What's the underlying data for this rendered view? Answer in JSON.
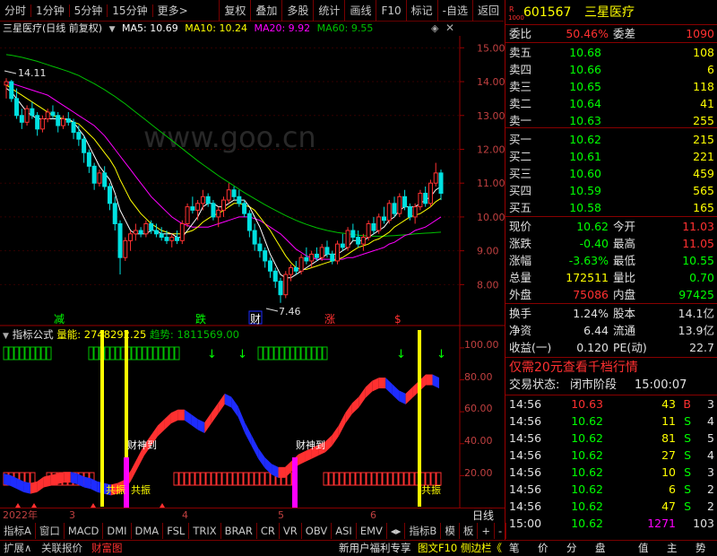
{
  "toolbar": {
    "left": [
      "分时",
      "1分钟",
      "5分钟",
      "15分钟",
      "更多>"
    ],
    "right": [
      "复权",
      "叠加",
      "多股",
      "统计",
      "画线",
      "F10",
      "标记",
      "-自选",
      "返回"
    ]
  },
  "info": {
    "stock": "三星医疗",
    "mode": "(日线 前复权)",
    "ma5": "MA5: 10.69",
    "ma10": "MA10: 10.24",
    "ma20": "MA20: 9.92",
    "ma60": "MA60: 9.55"
  },
  "watermark": "www.goo.cn",
  "colors": {
    "up": "#ff3232",
    "down": "#00e0e0",
    "ma5": "#ffffff",
    "ma10": "#ffff00",
    "ma20": "#ff00ff",
    "ma60": "#00c000",
    "green": "#00ff00",
    "red": "#ff3030",
    "yellow": "#ffff00",
    "cyan": "#00ffff",
    "blue": "#1e2cff",
    "magenta": "#ff00ff"
  },
  "price_axis": [
    "15.00",
    "14.00",
    "13.00",
    "12.00",
    "11.00",
    "10.00",
    "9.00",
    "8.00"
  ],
  "high_label": "14.11",
  "low_label": "7.46",
  "markers": {
    "jian": "减",
    "die": "跌",
    "cai": "财",
    "zhang": "涨",
    "dollar": "$"
  },
  "indicator": {
    "name": "指标公式",
    "liangneng": "量能: 2748292.25",
    "qushi": "趋势: 1811569.00",
    "axis": [
      "100.00",
      "80.00",
      "60.00",
      "40.00",
      "20.00"
    ],
    "caishen": "财神到",
    "gongzhen": "共振"
  },
  "chart_data": {
    "type": "candlestick",
    "ylim": [
      7.4,
      15.3
    ],
    "candles": [
      [
        13.9,
        14.1,
        13.5,
        14.0
      ],
      [
        14.0,
        14.05,
        13.4,
        13.5
      ],
      [
        13.5,
        13.8,
        12.9,
        13.0
      ],
      [
        13.0,
        13.2,
        12.6,
        12.8
      ],
      [
        12.8,
        13.3,
        12.7,
        13.2
      ],
      [
        13.2,
        13.4,
        12.9,
        13.0
      ],
      [
        13.0,
        13.1,
        12.4,
        12.6
      ],
      [
        12.6,
        13.0,
        12.5,
        12.9
      ],
      [
        12.9,
        13.2,
        12.8,
        13.1
      ],
      [
        13.1,
        13.3,
        12.9,
        13.0
      ],
      [
        13.0,
        13.1,
        12.5,
        12.7
      ],
      [
        12.7,
        13.0,
        12.6,
        12.9
      ],
      [
        12.9,
        13.1,
        12.7,
        12.8
      ],
      [
        12.8,
        12.9,
        12.3,
        12.5
      ],
      [
        12.5,
        12.7,
        12.1,
        12.3
      ],
      [
        12.3,
        12.4,
        11.6,
        11.9
      ],
      [
        11.9,
        12.0,
        11.3,
        11.5
      ],
      [
        11.5,
        11.6,
        10.8,
        11.0
      ],
      [
        11.0,
        11.4,
        10.9,
        11.3
      ],
      [
        11.3,
        11.5,
        10.8,
        10.9
      ],
      [
        10.9,
        11.0,
        10.2,
        10.4
      ],
      [
        10.4,
        10.6,
        9.6,
        9.8
      ],
      [
        9.8,
        9.9,
        8.3,
        8.8
      ],
      [
        8.8,
        9.4,
        8.7,
        9.3
      ],
      [
        9.3,
        9.6,
        9.0,
        9.5
      ],
      [
        9.5,
        9.8,
        9.3,
        9.6
      ],
      [
        9.6,
        9.7,
        9.4,
        9.5
      ],
      [
        9.5,
        9.9,
        9.4,
        9.8
      ],
      [
        9.8,
        9.9,
        9.5,
        9.6
      ],
      [
        9.6,
        9.8,
        9.4,
        9.5
      ],
      [
        9.5,
        9.7,
        9.3,
        9.4
      ],
      [
        9.4,
        9.6,
        9.2,
        9.3
      ],
      [
        9.3,
        9.5,
        9.1,
        9.4
      ],
      [
        9.4,
        9.6,
        9.2,
        9.3
      ],
      [
        9.3,
        9.9,
        9.2,
        9.8
      ],
      [
        9.8,
        10.4,
        9.7,
        10.3
      ],
      [
        10.3,
        10.6,
        10.1,
        10.2
      ],
      [
        10.2,
        10.5,
        9.9,
        10.4
      ],
      [
        10.4,
        10.8,
        10.2,
        10.6
      ],
      [
        10.6,
        10.7,
        10.3,
        10.4
      ],
      [
        10.4,
        10.5,
        9.9,
        10.0
      ],
      [
        10.0,
        10.3,
        9.7,
        10.2
      ],
      [
        10.2,
        10.6,
        10.0,
        10.5
      ],
      [
        10.5,
        11.0,
        10.4,
        10.8
      ],
      [
        10.8,
        10.9,
        10.5,
        10.6
      ],
      [
        10.6,
        10.8,
        10.3,
        10.4
      ],
      [
        10.4,
        10.5,
        10.0,
        10.1
      ],
      [
        10.1,
        10.2,
        9.4,
        9.6
      ],
      [
        9.6,
        9.8,
        9.0,
        9.2
      ],
      [
        9.2,
        9.4,
        8.8,
        9.0
      ],
      [
        9.0,
        9.1,
        8.5,
        8.7
      ],
      [
        8.7,
        8.8,
        8.2,
        8.4
      ],
      [
        8.4,
        8.5,
        7.9,
        8.1
      ],
      [
        8.1,
        8.2,
        7.46,
        7.7
      ],
      [
        7.7,
        8.4,
        7.6,
        8.3
      ],
      [
        8.3,
        8.6,
        8.1,
        8.5
      ],
      [
        8.5,
        8.7,
        8.3,
        8.4
      ],
      [
        8.4,
        8.9,
        8.3,
        8.8
      ],
      [
        8.8,
        9.1,
        8.6,
        8.7
      ],
      [
        8.7,
        9.0,
        8.5,
        8.9
      ],
      [
        8.9,
        9.1,
        8.7,
        8.8
      ],
      [
        8.8,
        9.2,
        8.7,
        9.1
      ],
      [
        9.1,
        9.3,
        8.8,
        8.9
      ],
      [
        8.9,
        9.0,
        8.6,
        8.7
      ],
      [
        8.7,
        9.3,
        8.6,
        9.2
      ],
      [
        9.2,
        9.5,
        9.0,
        9.1
      ],
      [
        9.1,
        9.7,
        9.0,
        9.6
      ],
      [
        9.6,
        9.8,
        9.3,
        9.4
      ],
      [
        9.4,
        9.6,
        9.1,
        9.2
      ],
      [
        9.2,
        9.5,
        9.0,
        9.4
      ],
      [
        9.4,
        9.9,
        9.3,
        9.8
      ],
      [
        9.8,
        10.0,
        9.5,
        9.6
      ],
      [
        9.6,
        10.1,
        9.5,
        10.0
      ],
      [
        10.0,
        10.3,
        9.8,
        9.9
      ],
      [
        9.9,
        10.5,
        9.8,
        10.4
      ],
      [
        10.4,
        10.6,
        10.0,
        10.1
      ],
      [
        10.1,
        10.7,
        10.0,
        10.6
      ],
      [
        10.6,
        10.8,
        10.2,
        10.3
      ],
      [
        10.3,
        10.4,
        9.9,
        10.0
      ],
      [
        10.0,
        10.4,
        9.8,
        10.3
      ],
      [
        10.3,
        10.8,
        10.2,
        10.7
      ],
      [
        10.7,
        10.9,
        10.3,
        10.4
      ],
      [
        10.4,
        11.1,
        10.3,
        11.0
      ],
      [
        11.0,
        11.6,
        10.9,
        11.3
      ],
      [
        11.3,
        11.4,
        10.5,
        10.7
      ]
    ],
    "ma5": [
      13.8,
      13.7,
      13.5,
      13.3,
      13.1,
      13.0,
      12.9,
      12.9,
      12.9,
      12.9,
      12.9,
      12.9,
      12.9,
      12.8,
      12.6,
      12.4,
      12.1,
      11.8,
      11.5,
      11.3,
      11.1,
      10.7,
      10.2,
      9.9,
      9.6,
      9.5,
      9.5,
      9.5,
      9.6,
      9.6,
      9.5,
      9.5,
      9.5,
      9.4,
      9.4,
      9.6,
      9.8,
      10.0,
      10.3,
      10.4,
      10.4,
      10.3,
      10.3,
      10.4,
      10.5,
      10.5,
      10.5,
      10.3,
      10.0,
      9.7,
      9.3,
      8.9,
      8.6,
      8.3,
      8.2,
      8.2,
      8.3,
      8.4,
      8.5,
      8.6,
      8.7,
      8.8,
      8.9,
      8.9,
      8.9,
      9.0,
      9.1,
      9.3,
      9.3,
      9.3,
      9.4,
      9.5,
      9.6,
      9.7,
      9.9,
      10.0,
      10.2,
      10.3,
      10.3,
      10.3,
      10.4,
      10.5,
      10.6,
      10.8,
      10.9
    ],
    "ma10": [
      13.9,
      13.8,
      13.7,
      13.6,
      13.5,
      13.4,
      13.3,
      13.2,
      13.1,
      13.0,
      12.95,
      12.9,
      12.85,
      12.8,
      12.75,
      12.6,
      12.45,
      12.3,
      12.1,
      11.9,
      11.7,
      11.45,
      11.1,
      10.8,
      10.5,
      10.3,
      10.1,
      9.95,
      9.8,
      9.7,
      9.6,
      9.55,
      9.5,
      9.5,
      9.5,
      9.55,
      9.6,
      9.7,
      9.85,
      9.95,
      10.05,
      10.1,
      10.2,
      10.3,
      10.4,
      10.4,
      10.35,
      10.3,
      10.2,
      10.0,
      9.8,
      9.6,
      9.35,
      9.1,
      8.85,
      8.65,
      8.5,
      8.45,
      8.45,
      8.5,
      8.55,
      8.6,
      8.65,
      8.7,
      8.75,
      8.8,
      8.9,
      9.0,
      9.1,
      9.15,
      9.2,
      9.3,
      9.35,
      9.45,
      9.55,
      9.7,
      9.8,
      9.9,
      10.0,
      10.05,
      10.1,
      10.2,
      10.3,
      10.45,
      10.55
    ],
    "ma20": [
      14.0,
      13.95,
      13.9,
      13.85,
      13.8,
      13.75,
      13.7,
      13.65,
      13.6,
      13.5,
      13.4,
      13.3,
      13.2,
      13.1,
      13.0,
      12.9,
      12.8,
      12.7,
      12.55,
      12.4,
      12.2,
      12.0,
      11.8,
      11.6,
      11.4,
      11.2,
      11.0,
      10.8,
      10.6,
      10.45,
      10.3,
      10.15,
      10.0,
      9.9,
      9.8,
      9.75,
      9.7,
      9.7,
      9.7,
      9.7,
      9.75,
      9.8,
      9.85,
      9.9,
      9.95,
      10.0,
      10.0,
      10.0,
      9.95,
      9.9,
      9.8,
      9.7,
      9.6,
      9.5,
      9.35,
      9.2,
      9.05,
      8.95,
      8.85,
      8.8,
      8.75,
      8.75,
      8.75,
      8.75,
      8.75,
      8.75,
      8.8,
      8.8,
      8.85,
      8.9,
      8.95,
      9.0,
      9.05,
      9.1,
      9.2,
      9.25,
      9.35,
      9.45,
      9.5,
      9.6,
      9.65,
      9.7,
      9.8,
      9.9,
      10.0
    ],
    "ma60": [
      14.8,
      14.78,
      14.75,
      14.72,
      14.68,
      14.64,
      14.6,
      14.55,
      14.5,
      14.45,
      14.4,
      14.35,
      14.3,
      14.24,
      14.18,
      14.1,
      14.02,
      13.94,
      13.85,
      13.76,
      13.66,
      13.56,
      13.45,
      13.34,
      13.22,
      13.1,
      12.98,
      12.86,
      12.74,
      12.62,
      12.5,
      12.38,
      12.26,
      12.14,
      12.02,
      11.9,
      11.78,
      11.66,
      11.55,
      11.44,
      11.33,
      11.22,
      11.12,
      11.02,
      10.92,
      10.82,
      10.72,
      10.63,
      10.54,
      10.45,
      10.36,
      10.28,
      10.2,
      10.12,
      10.04,
      9.97,
      9.9,
      9.84,
      9.78,
      9.73,
      9.68,
      9.64,
      9.6,
      9.57,
      9.54,
      9.52,
      9.5,
      9.48,
      9.46,
      9.45,
      9.44,
      9.43,
      9.43,
      9.43,
      9.44,
      9.45,
      9.46,
      9.47,
      9.48,
      9.5,
      9.51,
      9.52,
      9.53,
      9.54,
      9.55
    ],
    "osc": [
      18,
      17,
      15,
      13,
      12,
      13,
      16,
      17,
      18,
      19,
      19,
      18,
      16,
      15,
      13,
      12,
      11,
      12,
      14,
      20,
      28,
      36,
      42,
      48,
      52,
      56,
      58,
      58,
      55,
      52,
      50,
      56,
      62,
      68,
      66,
      60,
      50,
      42,
      34,
      28,
      24,
      22,
      22,
      26,
      30,
      32,
      34,
      36,
      38,
      42,
      48,
      56,
      62,
      66,
      72,
      76,
      78,
      78,
      74,
      70,
      68,
      72,
      76,
      80,
      80,
      78
    ]
  },
  "date_axis": [
    "2022年",
    "3",
    "4",
    "5",
    "6"
  ],
  "quote": {
    "code": "601567",
    "name": "三星医疗",
    "r": "R",
    "weibi_label": "委比",
    "weibi": "50.46%",
    "weicha_label": "委差",
    "weicha": "1090",
    "asks": [
      {
        "label": "卖五",
        "price": "10.68",
        "vol": "108"
      },
      {
        "label": "卖四",
        "price": "10.66",
        "vol": "6"
      },
      {
        "label": "卖三",
        "price": "10.65",
        "vol": "118"
      },
      {
        "label": "卖二",
        "price": "10.64",
        "vol": "41"
      },
      {
        "label": "卖一",
        "price": "10.63",
        "vol": "255"
      }
    ],
    "bids": [
      {
        "label": "买一",
        "price": "10.62",
        "vol": "215"
      },
      {
        "label": "买二",
        "price": "10.61",
        "vol": "221"
      },
      {
        "label": "买三",
        "price": "10.60",
        "vol": "459"
      },
      {
        "label": "买四",
        "price": "10.59",
        "vol": "565"
      },
      {
        "label": "买五",
        "price": "10.58",
        "vol": "165"
      }
    ],
    "stats": [
      {
        "l1": "现价",
        "v1": "10.62",
        "c1": "#00ff00",
        "l2": "今开",
        "v2": "11.03",
        "c2": "#ff3030"
      },
      {
        "l1": "涨跌",
        "v1": "-0.40",
        "c1": "#00ff00",
        "l2": "最高",
        "v2": "11.05",
        "c2": "#ff3030"
      },
      {
        "l1": "涨幅",
        "v1": "-3.63%",
        "c1": "#00ff00",
        "l2": "最低",
        "v2": "10.55",
        "c2": "#00ff00"
      },
      {
        "l1": "总量",
        "v1": "172511",
        "c1": "#ffff00",
        "l2": "量比",
        "v2": "0.70",
        "c2": "#00ff00"
      },
      {
        "l1": "外盘",
        "v1": "75086",
        "c1": "#ff3030",
        "l2": "内盘",
        "v2": "97425",
        "c2": "#00ff00"
      }
    ],
    "stats2": [
      {
        "l1": "换手",
        "v1": "1.24%",
        "l2": "股本",
        "v2": "14.1亿"
      },
      {
        "l1": "净资",
        "v1": "6.44",
        "l2": "流通",
        "v2": "13.9亿"
      },
      {
        "l1": "收益(一)",
        "v1": "0.120",
        "l2": "PE(动)",
        "v2": "22.7"
      }
    ],
    "promo": "仅需20元查看千档行情",
    "status_label": "交易状态:",
    "status": "闭市阶段",
    "status_time": "15:00:07",
    "ticks": [
      {
        "t": "14:56",
        "p": "10.63",
        "v": "43",
        "s": "B"
      },
      {
        "t": "14:56",
        "p": "10.62",
        "v": "11",
        "s": "S"
      },
      {
        "t": "14:56",
        "p": "10.62",
        "v": "81",
        "s": "S"
      },
      {
        "t": "14:56",
        "p": "10.62",
        "v": "27",
        "s": "S"
      },
      {
        "t": "14:56",
        "p": "10.62",
        "v": "10",
        "s": "S"
      },
      {
        "t": "14:56",
        "p": "10.62",
        "v": "6",
        "s": "S"
      },
      {
        "t": "14:56",
        "p": "10.62",
        "v": "47",
        "s": "S"
      },
      {
        "t": "15:00",
        "p": "10.62",
        "v": "1271",
        "s": "103"
      }
    ],
    "tick_counts": [
      "3",
      "4",
      "5",
      "4",
      "3",
      "2",
      "2",
      ""
    ]
  },
  "bottom": {
    "tabs": [
      "指标A",
      "窗口",
      "MACD",
      "DMI",
      "DMA",
      "FSL",
      "TRIX",
      "BRAR",
      "CR",
      "VR",
      "OBV",
      "ASI",
      "EMV",
      "",
      "指标B",
      "模",
      "板",
      "+",
      "-"
    ],
    "day_label": "日线",
    "row3_left": [
      "扩展∧",
      "关联报价",
      "财富图"
    ],
    "row3_mid": [
      "新用户福利专享",
      "图文F10",
      "侧边栏《"
    ],
    "row3_right": [
      "笔",
      "价",
      "分",
      "盘",
      "值",
      "主",
      "势"
    ]
  }
}
